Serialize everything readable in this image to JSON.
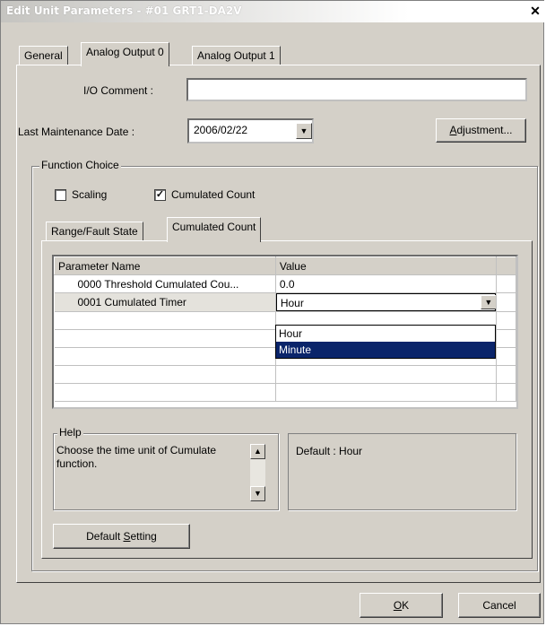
{
  "window": {
    "title": "Edit Unit Parameters - #01 GRT1-DA2V",
    "close_glyph": "✕"
  },
  "tabs": [
    {
      "label": "General"
    },
    {
      "label": "Analog Output 0"
    },
    {
      "label": "Analog Output 1"
    }
  ],
  "io_comment": {
    "label": "I/O Comment :",
    "value": ""
  },
  "maintenance": {
    "label": "Last Maintenance Date :",
    "value": "2006/02/22"
  },
  "adjustment_button": {
    "prefix": "A",
    "rest": "djustment..."
  },
  "function_choice": {
    "legend": "Function Choice",
    "scaling": {
      "label": "Scaling",
      "checked": false
    },
    "cumulated": {
      "label": "Cumulated Count",
      "checked": true,
      "mark": "✓"
    }
  },
  "inner_tabs": [
    {
      "label": "Range/Fault State"
    },
    {
      "label": "Cumulated Count"
    }
  ],
  "grid": {
    "headers": [
      "Parameter Name",
      "Value"
    ],
    "rows": [
      {
        "name": "0000 Threshold Cumulated Cou...",
        "value": "0.0"
      },
      {
        "name": "0001 Cumulated Timer",
        "value": "Hour"
      }
    ]
  },
  "dropdown": {
    "options": [
      "Hour",
      "Minute"
    ],
    "highlighted": "Minute"
  },
  "help": {
    "legend": "Help",
    "text": "Choose the time unit of Cumulate function.",
    "default_text": "Default : Hour"
  },
  "default_setting_button": {
    "prefix": "Default ",
    "underlined": "S",
    "rest": "etting"
  },
  "ok_button": {
    "prefix": "O",
    "rest": "K"
  },
  "cancel_button": {
    "label": "Cancel"
  },
  "colors": {
    "selection": "#0a246a",
    "face": "#d4d0c8"
  }
}
